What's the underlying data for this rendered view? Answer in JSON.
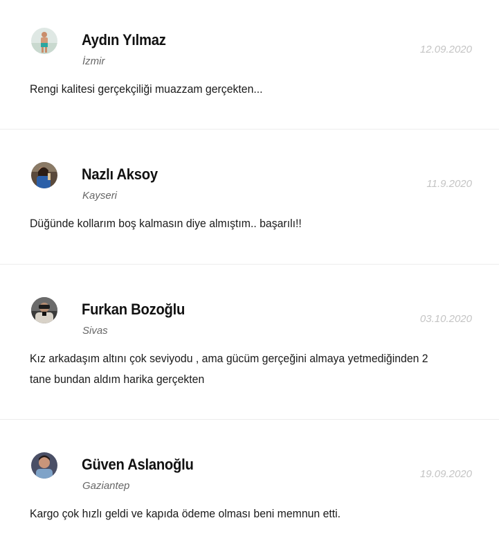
{
  "reviews": [
    {
      "name": "Aydın Yılmaz",
      "city": "İzmir",
      "date": "12.09.2020",
      "comment": "Rengi kalitesi gerçekçiliği muazzam gerçekten...",
      "avatar_icon": "user-avatar-photo"
    },
    {
      "name": "Nazlı Aksoy",
      "city": "Kayseri",
      "date": "11.9.2020",
      "comment": "Düğünde kollarım boş kalmasın diye almıştım.. başarılı!!",
      "avatar_icon": "user-avatar-photo"
    },
    {
      "name": "Furkan Bozoğlu",
      "city": "Sivas",
      "date": "03.10.2020",
      "comment": "Kız arkadaşım altını çok seviyodu , ama gücüm gerçeğini almaya yetmediğinden 2 tane bundan aldım harika gerçekten",
      "avatar_icon": "user-avatar-photo"
    },
    {
      "name": "Güven Aslanoğlu",
      "city": "Gaziantep",
      "date": "19.09.2020",
      "comment": "Kargo çok hızlı geldi ve kapıda ödeme olması beni memnun etti.",
      "avatar_icon": "user-avatar-photo"
    }
  ],
  "colors": {
    "name": "#111111",
    "city": "#666666",
    "date": "#c4c4c4",
    "comment": "#1a1a1a",
    "divider": "#ececec"
  }
}
